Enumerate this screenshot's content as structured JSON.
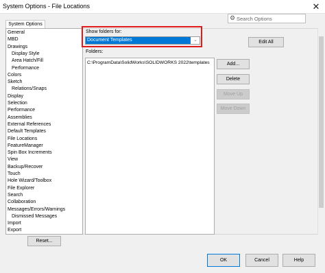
{
  "window": {
    "title": "System Options - File Locations",
    "close_glyph": "✕"
  },
  "search": {
    "placeholder": "Search Options",
    "icon": "gear-search-icon"
  },
  "tab": {
    "label": "System Options"
  },
  "tree": {
    "items": [
      {
        "label": "General",
        "indent": 0
      },
      {
        "label": "MBD",
        "indent": 0
      },
      {
        "label": "Drawings",
        "indent": 0
      },
      {
        "label": "Display Style",
        "indent": 1
      },
      {
        "label": "Area Hatch/Fill",
        "indent": 1
      },
      {
        "label": "Performance",
        "indent": 1
      },
      {
        "label": "Colors",
        "indent": 0
      },
      {
        "label": "Sketch",
        "indent": 0
      },
      {
        "label": "Relations/Snaps",
        "indent": 1
      },
      {
        "label": "Display",
        "indent": 0
      },
      {
        "label": "Selection",
        "indent": 0
      },
      {
        "label": "Performance",
        "indent": 0
      },
      {
        "label": "Assemblies",
        "indent": 0
      },
      {
        "label": "External References",
        "indent": 0
      },
      {
        "label": "Default Templates",
        "indent": 0
      },
      {
        "label": "File Locations",
        "indent": 0
      },
      {
        "label": "FeatureManager",
        "indent": 0
      },
      {
        "label": "Spin Box Increments",
        "indent": 0
      },
      {
        "label": "View",
        "indent": 0
      },
      {
        "label": "Backup/Recover",
        "indent": 0
      },
      {
        "label": "Touch",
        "indent": 0
      },
      {
        "label": "Hole Wizard/Toolbox",
        "indent": 0
      },
      {
        "label": "File Explorer",
        "indent": 0
      },
      {
        "label": "Search",
        "indent": 0
      },
      {
        "label": "Collaboration",
        "indent": 0
      },
      {
        "label": "Messages/Errors/Warnings",
        "indent": 0
      },
      {
        "label": "Dismissed Messages",
        "indent": 1
      },
      {
        "label": "Import",
        "indent": 0
      },
      {
        "label": "Export",
        "indent": 0
      }
    ]
  },
  "show_folders": {
    "label": "Show folders for:",
    "selected": "Document Templates",
    "arrow_glyph": "⌄"
  },
  "folders": {
    "label": "Folders:",
    "items": [
      "C:\\ProgramData\\SolidWorks\\SOLIDWORKS 2022\\templates"
    ]
  },
  "buttons": {
    "edit_all": "Edit All",
    "add": "Add...",
    "delete": "Delete",
    "move_up": "Move Up",
    "move_down": "Move Down",
    "reset": "Reset...",
    "ok": "OK",
    "cancel": "Cancel",
    "help": "Help"
  },
  "colors": {
    "highlight": "#e0191b",
    "selection": "#0078d7"
  }
}
